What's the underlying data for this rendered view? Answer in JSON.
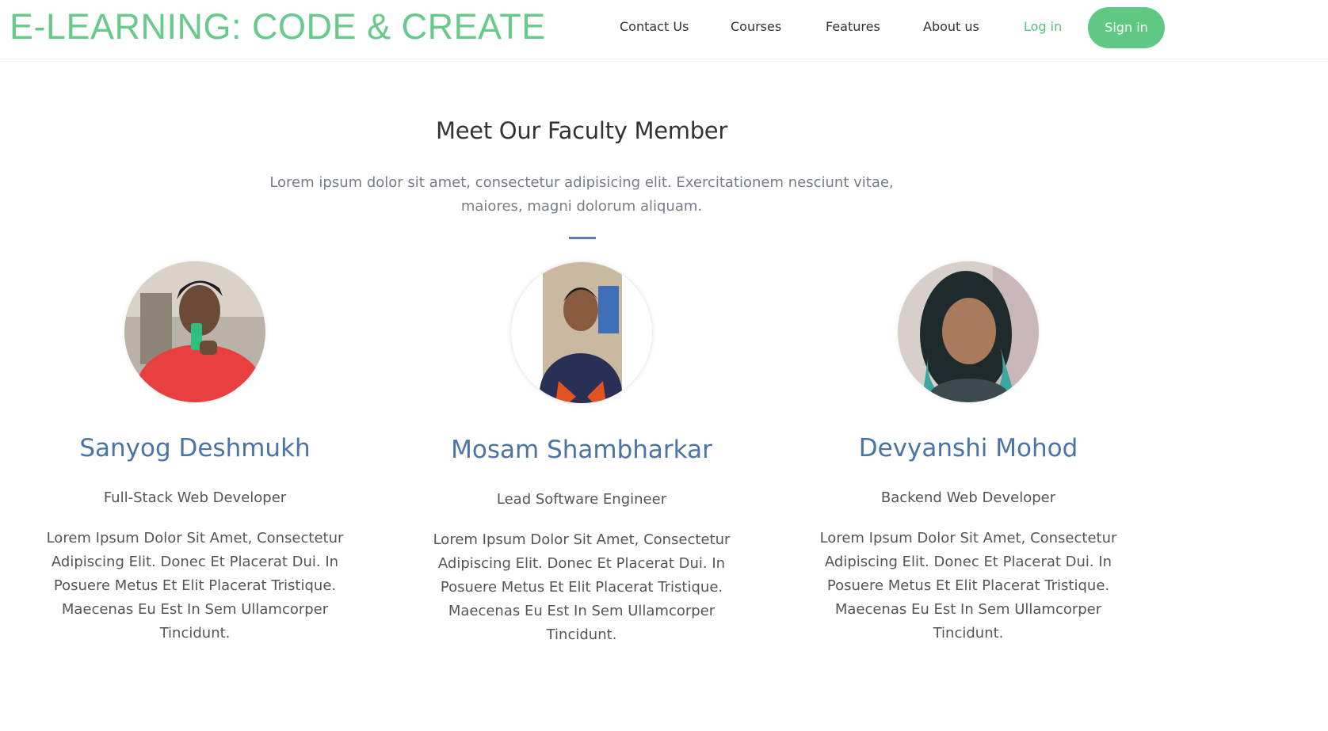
{
  "header": {
    "brand": "E-LEARNING: CODE & CREATE",
    "nav": {
      "contact": "Contact Us",
      "courses": "Courses",
      "features": "Features",
      "about": "About us",
      "login": "Log in",
      "signin": "Sign in"
    }
  },
  "faculty": {
    "title": "Meet Our Faculty Member",
    "subtitle": "Lorem ipsum dolor sit amet, consectetur adipisicing elit. Exercitationem nesciunt vitae, maiores, magni dolorum aliquam.",
    "members": [
      {
        "name": "Sanyog Deshmukh",
        "role": "Full-Stack Web Developer",
        "bio": "Lorem Ipsum Dolor Sit Amet, Consectetur Adipiscing Elit. Donec Et Placerat Dui. In Posuere Metus Et Elit Placerat Tristique. Maecenas Eu Est In Sem Ullamcorper Tincidunt."
      },
      {
        "name": "Mosam Shambharkar",
        "role": "Lead Software Engineer",
        "bio": "Lorem Ipsum Dolor Sit Amet, Consectetur Adipiscing Elit. Donec Et Placerat Dui. In Posuere Metus Et Elit Placerat Tristique. Maecenas Eu Est In Sem Ullamcorper Tincidunt."
      },
      {
        "name": "Devyanshi Mohod",
        "role": "Backend Web Developer",
        "bio": "Lorem Ipsum Dolor Sit Amet, Consectetur Adipiscing Elit. Donec Et Placerat Dui. In Posuere Metus Et Elit Placerat Tristique. Maecenas Eu Est In Sem Ullamcorper Tincidunt."
      }
    ]
  },
  "colors": {
    "brand": "#67c98a",
    "accent_button": "#5fc983",
    "name_blue": "#4a74a6"
  }
}
